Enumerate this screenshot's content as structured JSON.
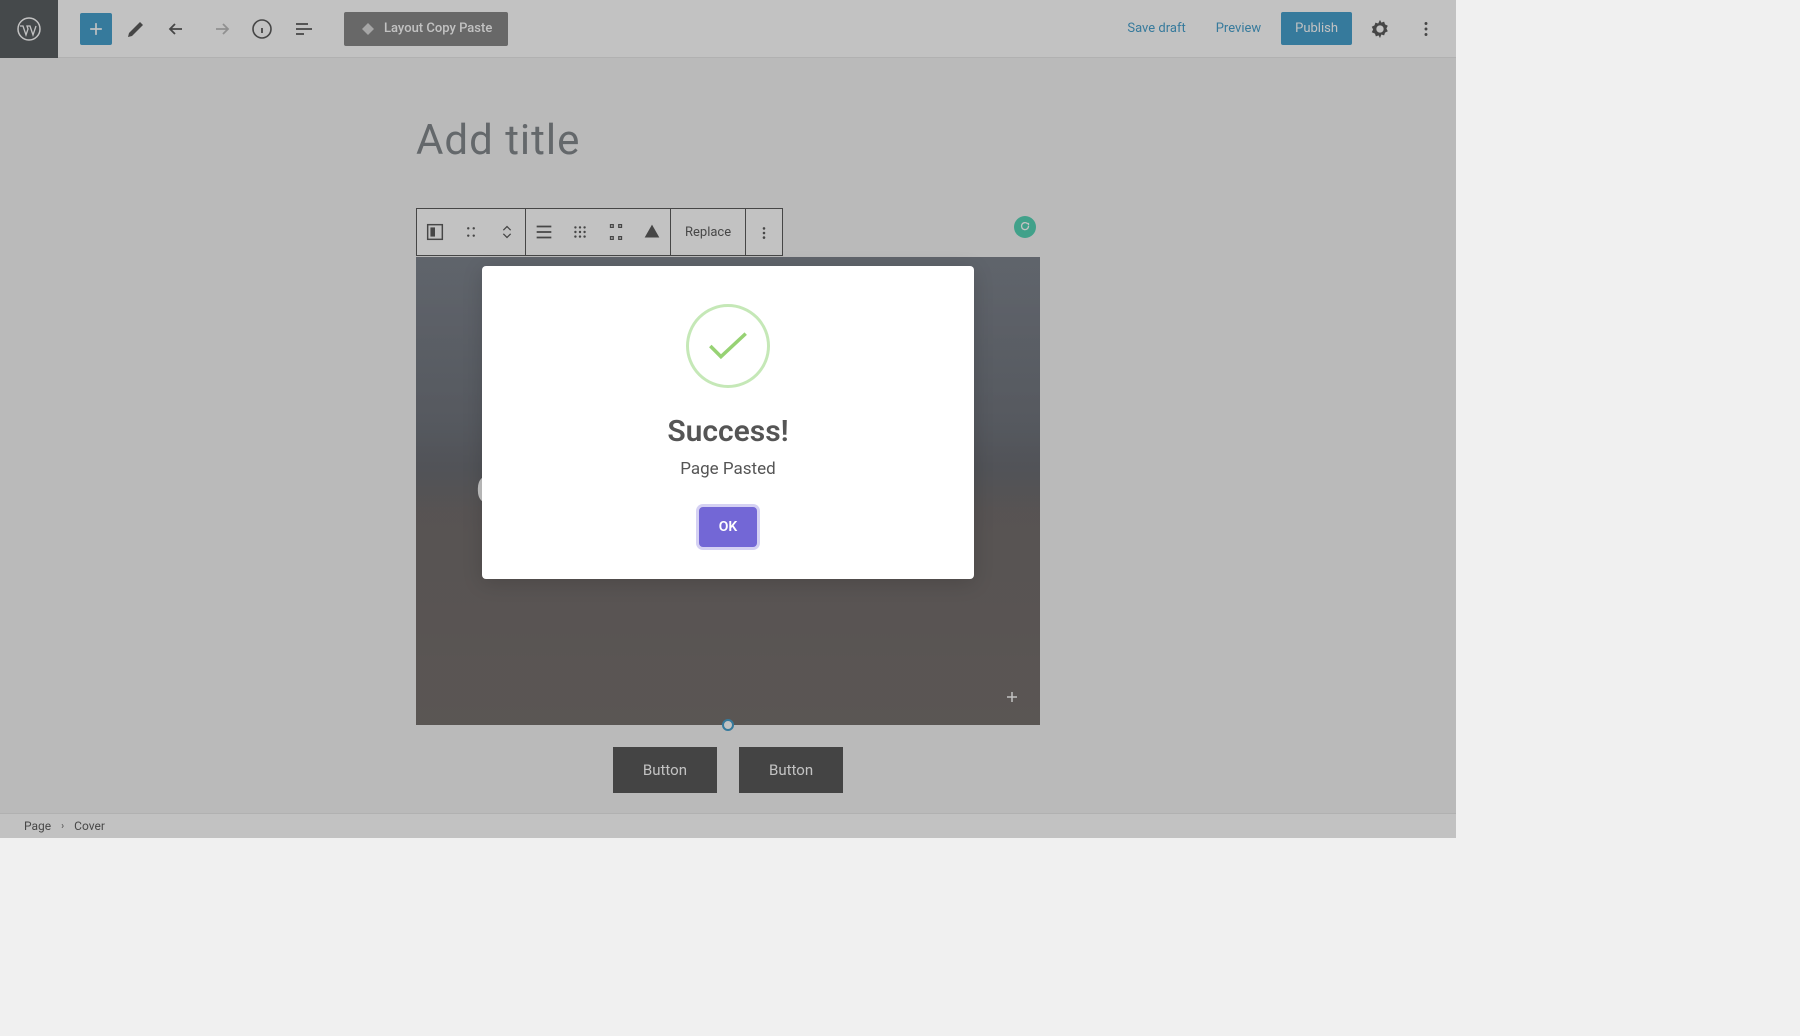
{
  "toolbar": {
    "layout_copy_paste": "Layout Copy Paste",
    "save_draft": "Save draft",
    "preview": "Preview",
    "publish": "Publish"
  },
  "editor": {
    "title_placeholder": "Add title",
    "block_toolbar": {
      "replace": "Replace"
    },
    "cover_title_partial": "C",
    "buttons": [
      "Button",
      "Button"
    ]
  },
  "modal": {
    "title": "Success!",
    "message": "Page Pasted",
    "ok": "OK"
  },
  "breadcrumb": {
    "root": "Page",
    "current": "Cover"
  }
}
